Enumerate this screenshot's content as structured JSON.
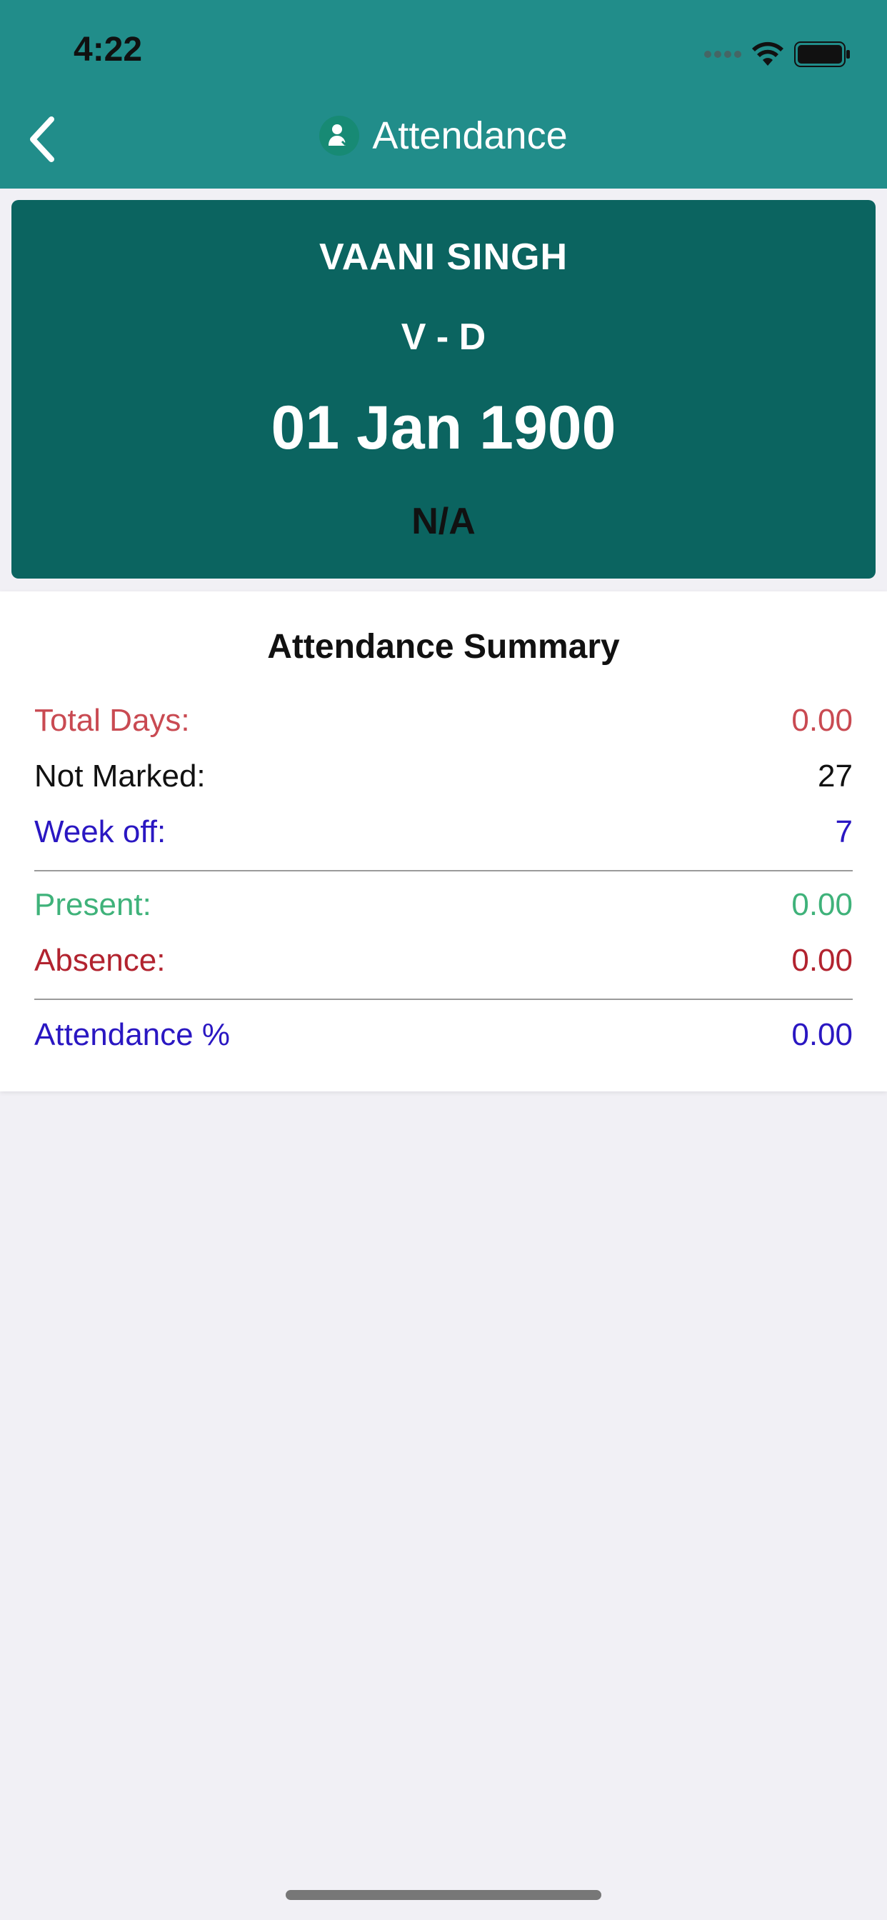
{
  "status_bar": {
    "time": "4:22"
  },
  "header": {
    "title": "Attendance"
  },
  "profile": {
    "name": "VAANI  SINGH",
    "class_section": "V - D",
    "date": "01 Jan 1900",
    "status": "N/A"
  },
  "summary": {
    "title": "Attendance Summary",
    "total_days": {
      "label": "Total Days:",
      "value": "0.00",
      "color": "#c94a52"
    },
    "not_marked": {
      "label": "Not Marked:",
      "value": "27",
      "color": "#111111"
    },
    "week_off": {
      "label": "Week off:",
      "value": "7",
      "color": "#2a17c2"
    },
    "present": {
      "label": "Present:",
      "value": "0.00",
      "color": "#3fb27a"
    },
    "absence": {
      "label": "Absence:",
      "value": "0.00",
      "color": "#b2232f"
    },
    "attendance_pct": {
      "label": "Attendance %",
      "value": "0.00",
      "color": "#2a17c2"
    }
  },
  "colors": {
    "header_bg": "#218d8a",
    "profile_bg": "#0b6460",
    "page_bg": "#f1f0f5"
  },
  "icons": {
    "back": "chevron-left-icon",
    "title": "student-attendance-icon",
    "wifi": "wifi-icon",
    "battery": "battery-icon",
    "signal": "signal-icon"
  }
}
